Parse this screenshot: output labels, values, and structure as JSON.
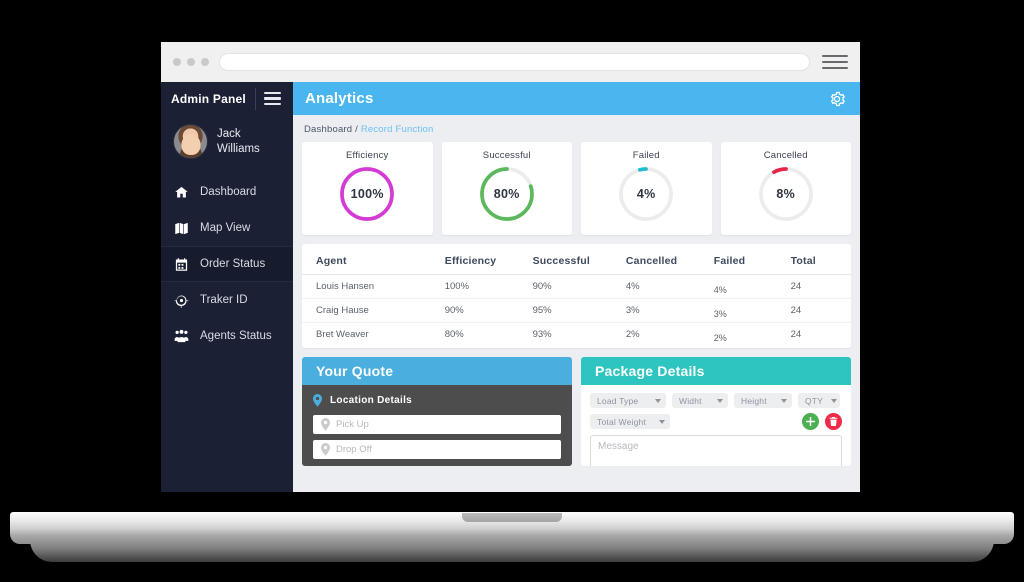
{
  "browser": {
    "url_value": "",
    "url_placeholder": "",
    "menu_icon": "hamburger-menu-icon",
    "dots": [
      "traffic-dot-1",
      "traffic-dot-2",
      "traffic-dot-3"
    ]
  },
  "sidebar": {
    "brand": "Admin Panel",
    "burger_icon": "hamburger-menu-icon",
    "user": {
      "name_line1": "Jack",
      "name_line2": "Williams",
      "avatar": "user-avatar"
    },
    "items": [
      {
        "label": "Dashboard",
        "icon": "home-icon",
        "active": false
      },
      {
        "label": "Map View",
        "icon": "map-icon",
        "active": false
      },
      {
        "label": "Order Status",
        "icon": "calendar-icon",
        "active": true
      },
      {
        "label": "Traker ID",
        "icon": "target-icon",
        "active": false
      },
      {
        "label": "Agents Status",
        "icon": "users-icon",
        "active": false
      }
    ]
  },
  "header": {
    "title": "Analytics",
    "settings_icon": "gear-icon",
    "accent_color": "#4ab6f0"
  },
  "breadcrumb": {
    "root": "Dashboard /",
    "current": "Record Function",
    "current_color": "#6cc0f2"
  },
  "chart_data": [
    {
      "type": "pie",
      "title": "Efficiency",
      "label": "Efficiency",
      "value": 100,
      "display": "100%",
      "color": "#d43bd4",
      "track": "#ececec",
      "max": 100
    },
    {
      "type": "pie",
      "title": "Successful",
      "label": "Successful",
      "value": 80,
      "display": "80%",
      "color": "#5cb85c",
      "track": "#ececec",
      "max": 100
    },
    {
      "type": "pie",
      "title": "Failed",
      "label": "Failed",
      "value": 4,
      "display": "4%",
      "color": "#1fbcd2",
      "track": "#ececec",
      "max": 100
    },
    {
      "type": "pie",
      "title": "Cancelled",
      "label": "Cancelled",
      "value": 8,
      "display": "8%",
      "color": "#e8234a",
      "track": "#ececec",
      "max": 100
    }
  ],
  "table": {
    "columns": [
      "Agent",
      "Efficiency",
      "Successful",
      "Cancelled",
      "Failed",
      "Total"
    ],
    "rows": [
      {
        "agent": "Louis Hansen",
        "efficiency": "100%",
        "successful": "90%",
        "cancelled": "4%",
        "failed": "4%",
        "total": "24"
      },
      {
        "agent": "Craig Hause",
        "efficiency": "90%",
        "successful": "95%",
        "cancelled": "3%",
        "failed": "3%",
        "total": "24"
      },
      {
        "agent": "Bret Weaver",
        "efficiency": "80%",
        "successful": "93%",
        "cancelled": "2%",
        "failed": "2%",
        "total": "24"
      }
    ]
  },
  "quote_panel": {
    "title": "Your Quote",
    "section_label": "Location Details",
    "pin_icon": "map-pin-icon",
    "pickup_placeholder": "Pick Up",
    "pickup_value": "",
    "dropoff_placeholder": "Drop Off",
    "dropoff_value": "",
    "header_color": "#4aaede"
  },
  "package_panel": {
    "title": "Package Details",
    "header_color": "#2ec4c0",
    "selects": [
      {
        "label": "Load Type",
        "name": "load-type-select"
      },
      {
        "label": "Widht",
        "name": "width-select"
      },
      {
        "label": "Height",
        "name": "height-select"
      },
      {
        "label": "QTY",
        "name": "qty-select"
      },
      {
        "label": "Total Weight",
        "name": "total-weight-select"
      }
    ],
    "add_icon": "plus-icon",
    "delete_icon": "trash-icon",
    "message_placeholder": "Message",
    "message_value": ""
  }
}
